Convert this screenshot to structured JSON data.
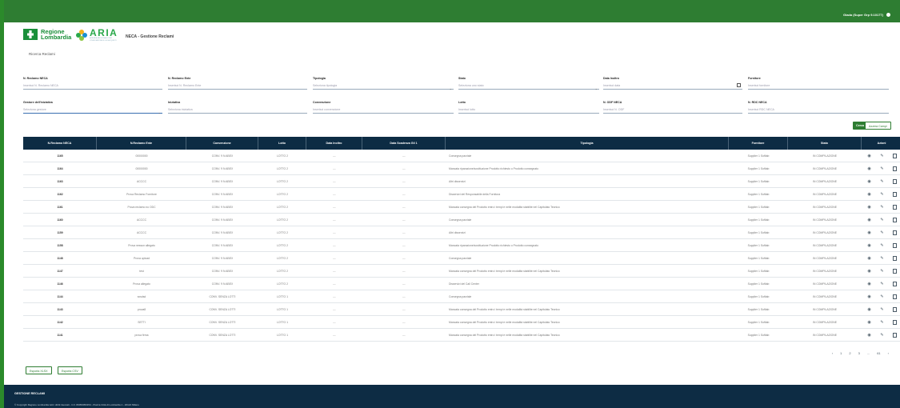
{
  "header": {
    "user_label": "Giada (Super Grp 9.10177)"
  },
  "brand": {
    "regione_line1": "Regione",
    "regione_line2": "Lombardia",
    "aria_word": "ARIA",
    "aria_sub1": "AZIENDA REGIONALE PER",
    "aria_sub2": "L'INNOVAZIONE E GLI ACQUISTI",
    "app_title": "NECA - Gestione Reclami"
  },
  "nav": {
    "tab_label": "Ricerca Reclami"
  },
  "filters": {
    "reclamo_neca": {
      "label": "N. Reclamo NECA",
      "placeholder": "Inserisci N. Reclamo NECA"
    },
    "reclamo_ente": {
      "label": "N. Reclamo Ente",
      "placeholder": "Inserisci N. Reclamo Ente"
    },
    "tipologia": {
      "label": "Tipologia",
      "placeholder": "Seleziona tipologia"
    },
    "stato": {
      "label": "Stato",
      "placeholder": "Seleziona uno stato"
    },
    "data_inoltro": {
      "label": "Data Inoltro",
      "placeholder": "Inserisci data"
    },
    "fornitore": {
      "label": "Fornitore",
      "placeholder": "Inserisci fornitore"
    },
    "gestore": {
      "label": "Gestore dell'iniziativa",
      "placeholder": "Seleziona gestore"
    },
    "iniziativa": {
      "label": "Iniziativa",
      "placeholder": "Seleziona iniziativa"
    },
    "convenzione": {
      "label": "Convenzione",
      "placeholder": "Inserisci convenzione"
    },
    "lotto": {
      "label": "Lotto",
      "placeholder": "Inserisci lotto"
    },
    "odf_neca": {
      "label": "N. ODF NECA",
      "placeholder": "Inserisci N. ODF"
    },
    "rdc_neca": {
      "label": "N. RDC NECA",
      "placeholder": "Inserisci RDC NECA"
    }
  },
  "buttons": {
    "search": "Cerca",
    "reset": "Azzera Campi",
    "export_xlsx": "Esporta XLSX",
    "export_csv": "Esporta CSV"
  },
  "table": {
    "headers": [
      "N.Reclamo NECA",
      "N.Reclamo Ente",
      "Convenzione",
      "Lotto",
      "Data Inoltro",
      "Data Scadenza Gil 1",
      "Tipologia",
      "Fornitore",
      "Stato",
      "Azioni"
    ],
    "rows": [
      [
        "1165",
        "00000000",
        "CONV. 9 N ABEX",
        "LOTTO 2",
        "---",
        "---",
        "Consegna parziale",
        "Supplier 1 Softlab",
        "IN COMPILAZIONE"
      ],
      [
        "1164",
        "00000000",
        "CONV. 9 N ABEX",
        "LOTTO 2",
        "---",
        "---",
        "Mancata riparazione/sostituzione Prodotto richiesto o Prodotto consegnato",
        "Supplier 1 Softlab",
        "IN COMPILAZIONE"
      ],
      [
        "1163",
        "ACCCC",
        "CONV. 9 N ABEX",
        "LOTTO 2",
        "---",
        "---",
        "Altri disservizi",
        "Supplier 1 Softlab",
        "IN COMPILAZIONE"
      ],
      [
        "1162",
        "Prova Reclamo Fornitore",
        "CONV. 9 N ABEX",
        "LOTTO 2",
        "---",
        "---",
        "Disservizi del Responsabile della Fornitura",
        "Supplier 1 Softlab",
        "IN COMPILAZIONE"
      ],
      [
        "1161",
        "Prova reclamo no ODC",
        "CONV. 9 N ABEX",
        "LOTTO 2",
        "---",
        "---",
        "Mancata consegna del Prodotto entro i tempi e nelle modalità stabilite nel Capitolato Tecnico",
        "Supplier 1 Softlab",
        "IN COMPILAZIONE"
      ],
      [
        "1160",
        "ACCCC",
        "CONV. 9 N ABEX",
        "LOTTO 2",
        "---",
        "---",
        "Consegna parziale",
        "Supplier 1 Softlab",
        "IN COMPILAZIONE"
      ],
      [
        "1159",
        "ACCCC",
        "CONV. 9 N ABEX",
        "LOTTO 2",
        "---",
        "---",
        "Altri disservizi",
        "Supplier 1 Softlab",
        "IN COMPILAZIONE"
      ],
      [
        "1158",
        "Prova nessun allegato",
        "CONV. 9 N ABEX",
        "LOTTO 2",
        "---",
        "---",
        "Mancata riparazione/sostituzione Prodotto richiesto o Prodotto consegnato",
        "Supplier 1 Softlab",
        "IN COMPILAZIONE"
      ],
      [
        "1148",
        "Prova upload",
        "CONV. 9 N ABEX",
        "LOTTO 2",
        "---",
        "---",
        "Consegna parziale",
        "Supplier 1 Softlab",
        "IN COMPILAZIONE"
      ],
      [
        "1147",
        "test",
        "CONV. 9 N ABEX",
        "LOTTO 2",
        "---",
        "---",
        "Mancata consegna del Prodotto entro i tempi e nelle modalità stabilite nel Capitolato Tecnico",
        "Supplier 1 Softlab",
        "IN COMPILAZIONE"
      ],
      [
        "1146",
        "Prova allegato",
        "CONV. 9 N ABEX",
        "LOTTO 2",
        "---",
        "---",
        "Disservizi del Call Center",
        "Supplier 1 Softlab",
        "IN COMPILAZIONE"
      ],
      [
        "1144",
        "sxsdsd",
        "CONV. SENZA LOTTI",
        "LOTTO 1",
        "---",
        "---",
        "Consegna parziale",
        "Supplier 1 Softlab",
        "IN COMPILAZIONE"
      ],
      [
        "1143",
        "prova8",
        "CONV. SENZA LOTTI",
        "LOTTO 1",
        "---",
        "---",
        "Mancata consegna del Prodotto entro i tempi e nelle modalità stabilite nel Capitolato Tecnico",
        "Supplier 1 Softlab",
        "IN COMPILAZIONE"
      ],
      [
        "1142",
        "SETTI",
        "CONV. SENZA LOTTI",
        "LOTTO 1",
        "---",
        "---",
        "Mancata consegna del Prodotto entro i tempi e nelle modalità stabilite nel Capitolato Tecnico",
        "Supplier 1 Softlab",
        "IN COMPILAZIONE"
      ],
      [
        "1141",
        "prova firma",
        "CONV. SENZA LOTTI",
        "LOTTO 1",
        "---",
        "---",
        "Mancata consegna del Prodotto entro i tempi e nelle modalità stabilite nel Capitolato Tecnico",
        "Supplier 1 Softlab",
        "IN COMPILAZIONE"
      ]
    ]
  },
  "pagination": {
    "prev": "‹",
    "pages": [
      "1",
      "2",
      "3",
      "...",
      "61"
    ],
    "next": "›"
  },
  "footer": {
    "title": "GESTIONE RECLAMI",
    "copyright": "© Copyright Regione Lombardia tutti i diritti riservati - C.F. 80050050154 - Piazza Città di Lombardia 1 - 20124 Milano"
  },
  "colors": {
    "green": "#2e7d32",
    "navy": "#0d2c44",
    "frame": "#2b8a2b"
  },
  "icons": {
    "user": "user-icon",
    "view": "eye-icon",
    "edit": "pencil-icon",
    "delete": "trash-icon",
    "calendar": "calendar-icon",
    "dropdown": "chevron-down-icon"
  }
}
